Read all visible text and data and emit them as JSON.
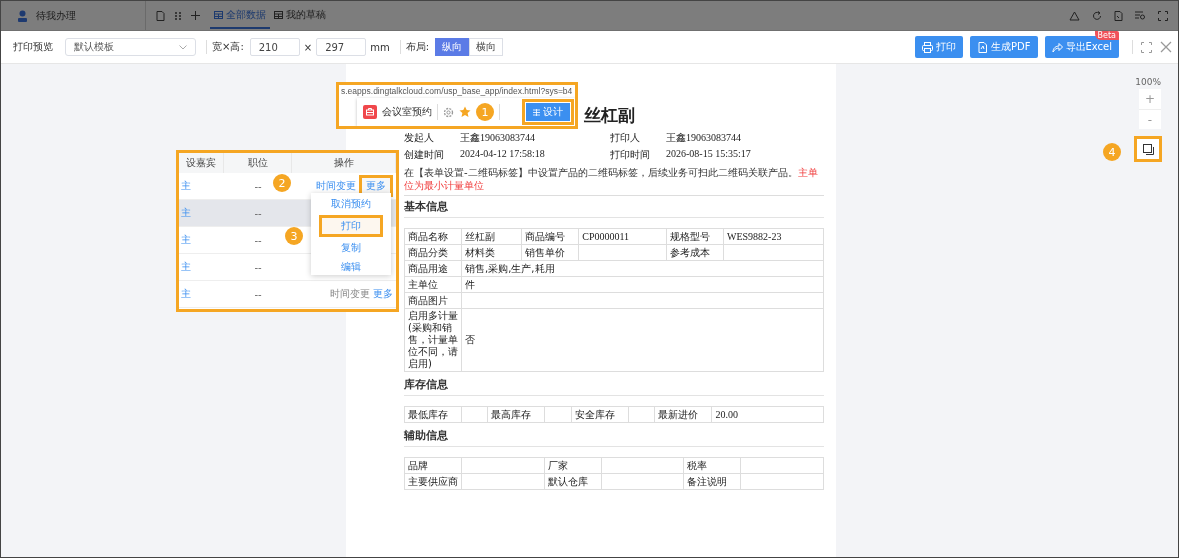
{
  "background_header": {
    "user_item": "待我办理",
    "tabs": [
      {
        "label": "全部数据",
        "selected": true
      },
      {
        "label": "我的草稿",
        "selected": false
      }
    ]
  },
  "toolbar": {
    "title": "打印预览",
    "template": {
      "value": "默认模板"
    },
    "size_label": "宽×高:",
    "width": {
      "value": "210"
    },
    "times": "×",
    "height": {
      "value": "297"
    },
    "unit": "mm",
    "layout_label": "布局:",
    "layout_options": [
      {
        "label": "纵向",
        "selected": true
      },
      {
        "label": "横向",
        "selected": false
      }
    ],
    "buttons": [
      {
        "label": "打印"
      },
      {
        "label": "生成PDF"
      },
      {
        "label": "导出Excel",
        "badge": "Beta"
      }
    ]
  },
  "zoom": {
    "percent": "100%",
    "zoom_in": "+",
    "zoom_out": "-",
    "badge": "4"
  },
  "app_bar_callout": {
    "badge": "1",
    "url": "s.eapps.dingtalkcloud.com/usp_base_app/index.html?sys=b4",
    "app_name": "会议室预约",
    "design_button": "设计"
  },
  "list_callout": {
    "columns": [
      "设嘉宾",
      "职位",
      "操作"
    ],
    "rows": [
      {
        "cells": [
          "主",
          "--"
        ],
        "actions": [
          "时间变更",
          "更多"
        ],
        "highlighted": false
      },
      {
        "cells": [
          "主",
          "--"
        ],
        "highlighted": true
      },
      {
        "cells": [
          "主",
          "--"
        ],
        "highlighted": false
      },
      {
        "cells": [
          "主",
          "--"
        ],
        "highlighted": false
      },
      {
        "cells": [
          "主",
          "--"
        ],
        "actions": [
          "时间变更",
          "更多"
        ],
        "highlighted": false
      }
    ],
    "more_badge": "2",
    "menu_badge": "3",
    "menu": [
      {
        "label": "取消预约",
        "selected": false
      },
      {
        "label": "打印",
        "selected": true
      },
      {
        "label": "复制",
        "selected": false
      },
      {
        "label": "编辑",
        "selected": false
      }
    ]
  },
  "document": {
    "title": "丝杠副",
    "meta": [
      [
        {
          "label": "发起人",
          "value": "王鑫19063083744"
        },
        {
          "label": "打印人",
          "value": "王鑫19063083744"
        }
      ],
      [
        {
          "label": "创建时间",
          "value": "2024-04-12 17:58:18"
        },
        {
          "label": "打印时间",
          "value": "2026-08-15 15:35:17"
        }
      ]
    ],
    "notice": {
      "text": "在【表单设置-二维码标签】中设置产品的二维码标签，后续业务可扫此二维码关联产品。",
      "highlight": "主单位为最小计量单位"
    },
    "sections": [
      {
        "heading": "基本信息",
        "rows": [
          [
            {
              "label": "商品名称",
              "value": "丝杠副"
            },
            {
              "label": "商品编号",
              "value": "CP0000011"
            },
            {
              "label": "规格型号",
              "value": "WES9882-23"
            }
          ],
          [
            {
              "label": "商品分类",
              "value": "材料类"
            },
            {
              "label": "销售单价"
            },
            {
              "label": "参考成本"
            }
          ],
          [
            {
              "label": "商品用途",
              "value": "销售,采购,生产,耗用"
            }
          ],
          [
            {
              "label": "主单位",
              "value": "件"
            }
          ],
          [
            {
              "label": "商品图片"
            }
          ],
          [
            {
              "label": "启用多计量(采购和销售，计量单位不同，请启用)",
              "value": "否"
            }
          ]
        ]
      },
      {
        "heading": "库存信息",
        "rows": [
          [
            {
              "label": "最低库存"
            },
            {
              "label": "最高库存"
            },
            {
              "label": "安全库存"
            },
            {
              "label": "最新进价",
              "value": "20.00"
            }
          ]
        ]
      },
      {
        "heading": "辅助信息",
        "rows": [
          [
            {
              "label": "品牌"
            },
            {
              "label": "厂家"
            },
            {
              "label": "税率"
            }
          ],
          [
            {
              "label": "主要供应商"
            },
            {
              "label": "默认仓库"
            },
            {
              "label": "备注说明"
            }
          ]
        ]
      }
    ]
  }
}
